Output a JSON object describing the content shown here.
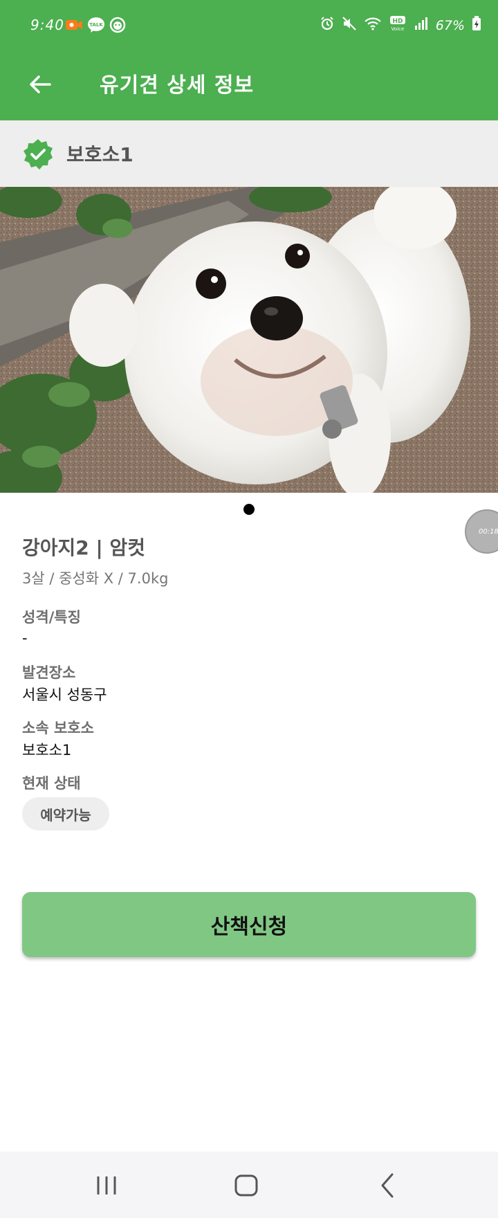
{
  "status_bar": {
    "time": "9:40",
    "battery": "67%",
    "hd_label": "HD",
    "hd_sub": "Voice",
    "talk_label": "TALK",
    "left_icons": [
      "video-record-icon",
      "kakaotalk-icon",
      "app-face-icon"
    ],
    "right_icons": [
      "alarm-icon",
      "mute-icon",
      "wifi-icon",
      "hd-voice-icon",
      "signal-icon",
      "battery-icon"
    ]
  },
  "header": {
    "title": "유기견 상세 정보",
    "back_icon": "arrow-left-icon"
  },
  "shelter": {
    "name": "보호소1",
    "verified_icon": "verified-badge-icon"
  },
  "photo": {
    "description_icon": "dog-photo",
    "page_index": 1,
    "page_count": 1
  },
  "floating_timer": {
    "text": "00:18"
  },
  "dog": {
    "title": "강아지2 | 암컷",
    "summary": "3살 / 중성화 X / 7.0kg",
    "personality_label": "성격/특징",
    "personality_value": "-",
    "found_place_label": "발견장소",
    "found_place_value": "서울시 성동구",
    "shelter_label": "소속 보호소",
    "shelter_value": "보호소1",
    "status_label": "현재 상태",
    "status_value": "예약가능"
  },
  "actions": {
    "walk_request": "산책신청"
  },
  "nav_bar": {
    "icons": [
      "recent-apps-icon",
      "home-icon",
      "back-icon"
    ]
  },
  "colors": {
    "primary": "#4caf50",
    "button": "#81c784",
    "shelter_bar": "#eeeeee",
    "chip": "#eeeeee"
  }
}
